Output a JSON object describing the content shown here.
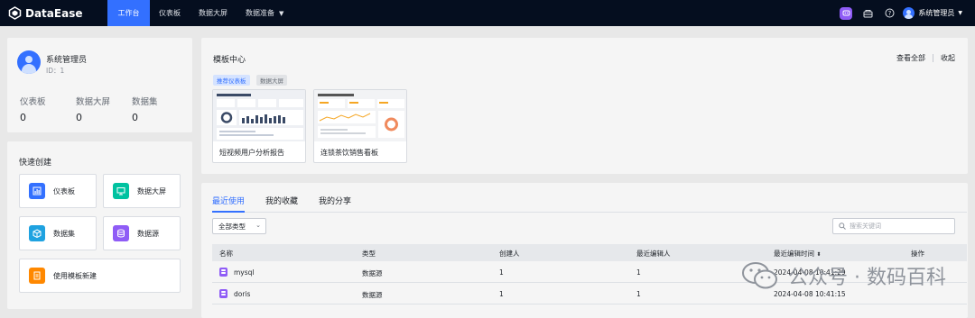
{
  "app": {
    "name": "DataEase"
  },
  "nav": {
    "tabs": [
      {
        "label": "工作台"
      },
      {
        "label": "仪表板"
      },
      {
        "label": "数据大屏"
      },
      {
        "label": "数据准备"
      }
    ]
  },
  "topbar": {
    "user_name": "系统管理员"
  },
  "user_card": {
    "name": "系统管理员",
    "id_text": "ID：1",
    "stats": [
      {
        "label": "仪表板",
        "value": "0"
      },
      {
        "label": "数据大屏",
        "value": "0"
      },
      {
        "label": "数据集",
        "value": "0"
      }
    ]
  },
  "quick_create": {
    "title": "快速创建",
    "items": [
      {
        "label": "仪表板",
        "color": "#3370ff",
        "icon": "dashboard-icon"
      },
      {
        "label": "数据大屏",
        "color": "#00c2a0",
        "icon": "screen-icon"
      },
      {
        "label": "数据集",
        "color": "#1fa2e0",
        "icon": "dataset-icon"
      },
      {
        "label": "数据源",
        "color": "#8f5cf6",
        "icon": "datasource-icon"
      },
      {
        "label": "使用模板新建",
        "color": "#ff8800",
        "icon": "template-icon"
      }
    ]
  },
  "templates": {
    "title": "模板中心",
    "view_all": "查看全部",
    "collapse": "收起",
    "chips": [
      {
        "label": "推荐仪表板"
      },
      {
        "label": "数据大屏"
      }
    ],
    "cards": [
      {
        "name": "短视频用户分析报告"
      },
      {
        "name": "连锁茶饮销售看板"
      }
    ]
  },
  "recent": {
    "tabs": [
      {
        "label": "最近使用"
      },
      {
        "label": "我的收藏"
      },
      {
        "label": "我的分享"
      }
    ],
    "type_filter": "全部类型",
    "search_placeholder": "搜索关键词",
    "columns": [
      "名称",
      "类型",
      "创建人",
      "最近编辑人",
      "最近编辑时间",
      "操作"
    ],
    "rows": [
      {
        "name": "mysql",
        "type": "数据源",
        "creator": "1",
        "editor": "1",
        "time": "2024-04-08 10:41:29"
      },
      {
        "name": "doris",
        "type": "数据源",
        "creator": "1",
        "editor": "1",
        "time": "2024-04-08 10:41:15"
      }
    ]
  },
  "watermark": {
    "text": "公众号 · 数码百科"
  },
  "colors": {
    "accent": "#3370ff",
    "topbar": "#050e1f",
    "ai": "#8f5cf6"
  }
}
